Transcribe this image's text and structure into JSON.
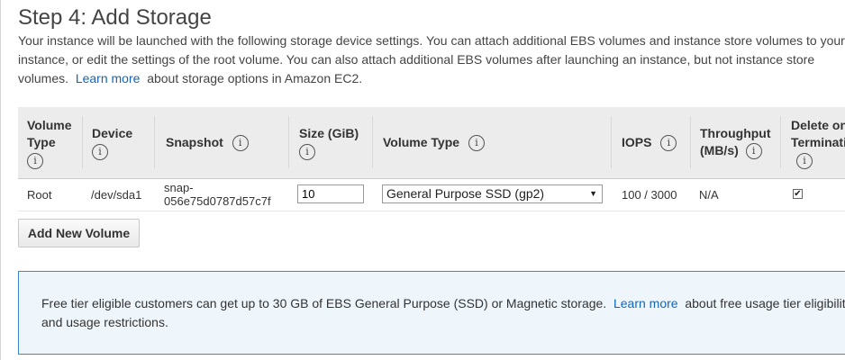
{
  "page": {
    "title": "Step 4: Add Storage",
    "desc_line1": "Your instance will be launched with the following storage device settings. You can attach additional EBS volumes and instance store volumes to your",
    "desc_line2": "instance, or edit the settings of the root volume. You can also attach additional EBS volumes after launching an instance, but not instance store",
    "desc_line3_pre": "volumes.",
    "learn_more": "Learn more",
    "desc_line3_post": "about storage options in Amazon EC2."
  },
  "table": {
    "headers": {
      "volume_type_1": "Volume",
      "volume_type_2": "Type",
      "device": "Device",
      "snapshot": "Snapshot",
      "size": "Size (GiB)",
      "volume_type_col": "Volume Type",
      "iops": "IOPS",
      "throughput_1": "Throughput",
      "throughput_2": "(MB/s)",
      "delete_1": "Delete on",
      "delete_2": "Termination"
    },
    "info_glyph": "i",
    "rows": [
      {
        "volume_type": "Root",
        "device": "/dev/sda1",
        "snapshot_1": "snap-",
        "snapshot_2": "056e75d0787d57c7f",
        "size": "10",
        "volume_type_value": "General Purpose SSD (gp2)",
        "iops": "100 / 3000",
        "throughput": "N/A",
        "delete_on_termination": true
      }
    ]
  },
  "buttons": {
    "add_volume": "Add New Volume"
  },
  "notice": {
    "text_pre": "Free tier eligible customers can get up to 30 GB of EBS General Purpose (SSD) or Magnetic storage.",
    "learn_more": "Learn more",
    "text_post": "about free usage tier eligibility and usage restrictions."
  },
  "colors": {
    "link": "#1166bb",
    "notice_border": "#3d87c7",
    "notice_background": "#eef6fc",
    "header_background": "#ececec"
  }
}
